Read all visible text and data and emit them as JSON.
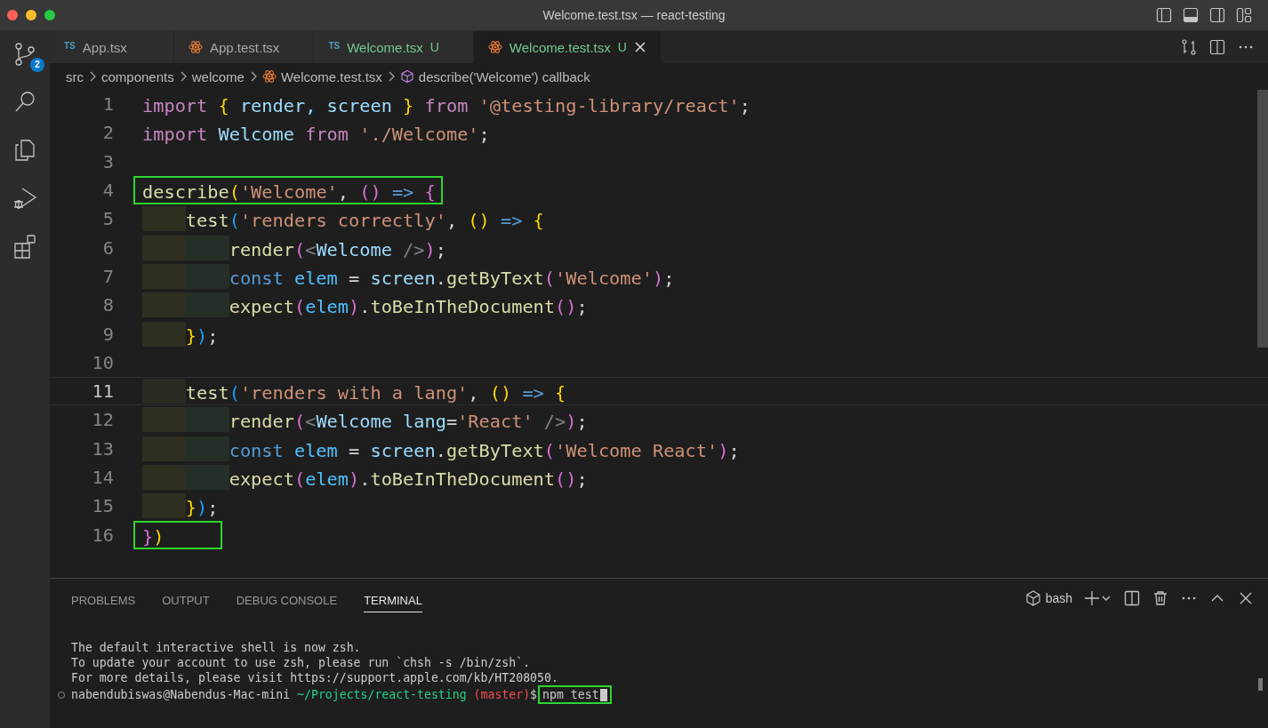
{
  "window": {
    "title": "Welcome.test.tsx — react-testing"
  },
  "activity_bar": {
    "source_control_badge": "2"
  },
  "tabs": [
    {
      "label": "App.tsx",
      "icon_text": "TS",
      "selected": false
    },
    {
      "label": "App.test.tsx",
      "selected": false
    },
    {
      "label": "Welcome.tsx",
      "icon_text": "TS",
      "status": "U",
      "selected": false
    },
    {
      "label": "Welcome.test.tsx",
      "status": "U",
      "selected": true
    }
  ],
  "breadcrumbs": [
    {
      "label": "src",
      "kind": "folder"
    },
    {
      "label": "components",
      "kind": "folder"
    },
    {
      "label": "welcome",
      "kind": "folder"
    },
    {
      "label": "Welcome.test.tsx",
      "kind": "file"
    },
    {
      "label": "describe('Welcome') callback",
      "kind": "symbol"
    }
  ],
  "editor": {
    "lines": [
      {
        "number": "1",
        "current": false,
        "annotated": false,
        "tokens": [
          {
            "text": "import ",
            "kind": "keyword"
          },
          {
            "text": "{",
            "kind": "bracket1"
          },
          {
            "text": " render, screen ",
            "kind": "variable"
          },
          {
            "text": "}",
            "kind": "bracket1"
          },
          {
            "text": " from ",
            "kind": "keyword"
          },
          {
            "text": "'@testing-library/react'",
            "kind": "string"
          },
          {
            "text": ";",
            "kind": "plain"
          }
        ]
      },
      {
        "number": "2",
        "current": false,
        "annotated": false,
        "tokens": [
          {
            "text": "import ",
            "kind": "keyword"
          },
          {
            "text": "Welcome ",
            "kind": "variable"
          },
          {
            "text": "from ",
            "kind": "keyword"
          },
          {
            "text": "'./Welcome'",
            "kind": "string"
          },
          {
            "text": ";",
            "kind": "plain"
          }
        ]
      },
      {
        "number": "3",
        "current": false,
        "annotated": false
      },
      {
        "number": "4",
        "current": false,
        "annotated": true,
        "tokens": [
          {
            "text": "describe",
            "kind": "function"
          },
          {
            "text": "(",
            "kind": "bracket1"
          },
          {
            "text": "'Welcome'",
            "kind": "string"
          },
          {
            "text": ", ",
            "kind": "plain"
          },
          {
            "text": "() ",
            "kind": "bracket2"
          },
          {
            "text": "=> ",
            "kind": "storage"
          },
          {
            "text": "{",
            "kind": "bracket2"
          }
        ]
      },
      {
        "number": "5",
        "current": false,
        "annotated": false,
        "tokens": [
          {
            "text": "    test",
            "kind": "function"
          },
          {
            "text": "(",
            "kind": "bracket3"
          },
          {
            "text": "'renders correctly'",
            "kind": "string"
          },
          {
            "text": ", ",
            "kind": "plain"
          },
          {
            "text": "() ",
            "kind": "bracket1"
          },
          {
            "text": "=> ",
            "kind": "storage"
          },
          {
            "text": "{",
            "kind": "bracket1"
          }
        ]
      },
      {
        "number": "6",
        "current": false,
        "annotated": false,
        "tokens": [
          {
            "text": "        render",
            "kind": "function"
          },
          {
            "text": "(",
            "kind": "bracket2"
          },
          {
            "text": "<",
            "kind": "tag"
          },
          {
            "text": "Welcome ",
            "kind": "variable"
          },
          {
            "text": "/>",
            "kind": "tag"
          },
          {
            "text": ")",
            "kind": "bracket2"
          },
          {
            "text": ";",
            "kind": "plain"
          }
        ]
      },
      {
        "number": "7",
        "current": false,
        "annotated": false,
        "tokens": [
          {
            "text": "        const ",
            "kind": "storage"
          },
          {
            "text": "elem",
            "kind": "constant"
          },
          {
            "text": " = ",
            "kind": "plain"
          },
          {
            "text": "screen",
            "kind": "variable"
          },
          {
            "text": ".",
            "kind": "plain"
          },
          {
            "text": "getByText",
            "kind": "function"
          },
          {
            "text": "(",
            "kind": "bracket2"
          },
          {
            "text": "'Welcome'",
            "kind": "string"
          },
          {
            "text": ")",
            "kind": "bracket2"
          },
          {
            "text": ";",
            "kind": "plain"
          }
        ]
      },
      {
        "number": "8",
        "current": false,
        "annotated": false,
        "tokens": [
          {
            "text": "        expect",
            "kind": "function"
          },
          {
            "text": "(",
            "kind": "bracket2"
          },
          {
            "text": "elem",
            "kind": "constant"
          },
          {
            "text": ")",
            "kind": "bracket2"
          },
          {
            "text": ".",
            "kind": "plain"
          },
          {
            "text": "toBeInTheDocument",
            "kind": "function"
          },
          {
            "text": "()",
            "kind": "bracket2"
          },
          {
            "text": ";",
            "kind": "plain"
          }
        ]
      },
      {
        "number": "9",
        "current": false,
        "annotated": false,
        "tokens": [
          {
            "text": "    }",
            "kind": "bracket1"
          },
          {
            "text": ")",
            "kind": "bracket3"
          },
          {
            "text": ";",
            "kind": "plain"
          }
        ]
      },
      {
        "number": "10",
        "current": false,
        "annotated": false
      },
      {
        "number": "11",
        "current": true,
        "annotated": false,
        "tokens": [
          {
            "text": "    test",
            "kind": "function"
          },
          {
            "text": "(",
            "kind": "bracket3"
          },
          {
            "text": "'renders with a lang'",
            "kind": "string"
          },
          {
            "text": ", ",
            "kind": "plain"
          },
          {
            "text": "() ",
            "kind": "bracket1"
          },
          {
            "text": "=> ",
            "kind": "storage"
          },
          {
            "text": "{",
            "kind": "bracket1"
          }
        ]
      },
      {
        "number": "12",
        "current": false,
        "annotated": false,
        "tokens": [
          {
            "text": "        render",
            "kind": "function"
          },
          {
            "text": "(",
            "kind": "bracket2"
          },
          {
            "text": "<",
            "kind": "tag"
          },
          {
            "text": "Welcome lang",
            "kind": "variable"
          },
          {
            "text": "=",
            "kind": "plain"
          },
          {
            "text": "'React' ",
            "kind": "string"
          },
          {
            "text": "/>",
            "kind": "tag"
          },
          {
            "text": ")",
            "kind": "bracket2"
          },
          {
            "text": ";",
            "kind": "plain"
          }
        ]
      },
      {
        "number": "13",
        "current": false,
        "annotated": false,
        "tokens": [
          {
            "text": "        const ",
            "kind": "storage"
          },
          {
            "text": "elem",
            "kind": "constant"
          },
          {
            "text": " = ",
            "kind": "plain"
          },
          {
            "text": "screen",
            "kind": "variable"
          },
          {
            "text": ".",
            "kind": "plain"
          },
          {
            "text": "getByText",
            "kind": "function"
          },
          {
            "text": "(",
            "kind": "bracket2"
          },
          {
            "text": "'Welcome React'",
            "kind": "string"
          },
          {
            "text": ")",
            "kind": "bracket2"
          },
          {
            "text": ";",
            "kind": "plain"
          }
        ]
      },
      {
        "number": "14",
        "current": false,
        "annotated": false,
        "tokens": [
          {
            "text": "        expect",
            "kind": "function"
          },
          {
            "text": "(",
            "kind": "bracket2"
          },
          {
            "text": "elem",
            "kind": "constant"
          },
          {
            "text": ")",
            "kind": "bracket2"
          },
          {
            "text": ".",
            "kind": "plain"
          },
          {
            "text": "toBeInTheDocument",
            "kind": "function"
          },
          {
            "text": "()",
            "kind": "bracket2"
          },
          {
            "text": ";",
            "kind": "plain"
          }
        ]
      },
      {
        "number": "15",
        "current": false,
        "annotated": false,
        "tokens": [
          {
            "text": "    }",
            "kind": "bracket1"
          },
          {
            "text": ")",
            "kind": "bracket3"
          },
          {
            "text": ";",
            "kind": "plain"
          }
        ]
      },
      {
        "number": "16",
        "current": false,
        "annotated": true,
        "tokens": [
          {
            "text": "}",
            "kind": "bracket2"
          },
          {
            "text": ")",
            "kind": "bracket1"
          }
        ]
      }
    ]
  },
  "panel": {
    "tabs": [
      {
        "label": "PROBLEMS",
        "selected": false
      },
      {
        "label": "OUTPUT",
        "selected": false
      },
      {
        "label": "DEBUG CONSOLE",
        "selected": false
      },
      {
        "label": "TERMINAL",
        "selected": true
      }
    ],
    "terminal": {
      "shell": "bash",
      "lines": [
        "The default interactive shell is now zsh.",
        "To update your account to use zsh, please run `chsh -s /bin/zsh`.",
        "For more details, please visit https://support.apple.com/kb/HT208050."
      ],
      "prompt": {
        "user_host": "nabendubiswas@Nabendus-Mac-mini",
        "path": "~/Projects/react-testing",
        "branch": "(master)",
        "symbol": "$",
        "command": "npm test",
        "annotated": true
      }
    }
  }
}
